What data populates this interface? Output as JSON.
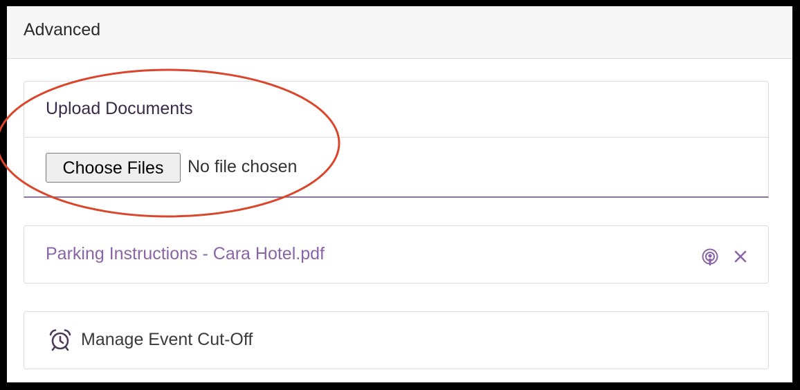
{
  "panel": {
    "title": "Advanced"
  },
  "upload": {
    "title": "Upload Documents",
    "button_label": "Choose Files",
    "status": "No file chosen"
  },
  "documents": [
    {
      "name": "Parking Instructions - Cara Hotel.pdf",
      "icons": [
        "podcast-icon",
        "close-icon"
      ]
    }
  ],
  "cutoff": {
    "label": "Manage Event Cut-Off",
    "icon": "alarm-clock-icon"
  },
  "colors": {
    "accent": "#8a64a6",
    "annotation": "#d9462c",
    "underline": "#8a7598"
  }
}
